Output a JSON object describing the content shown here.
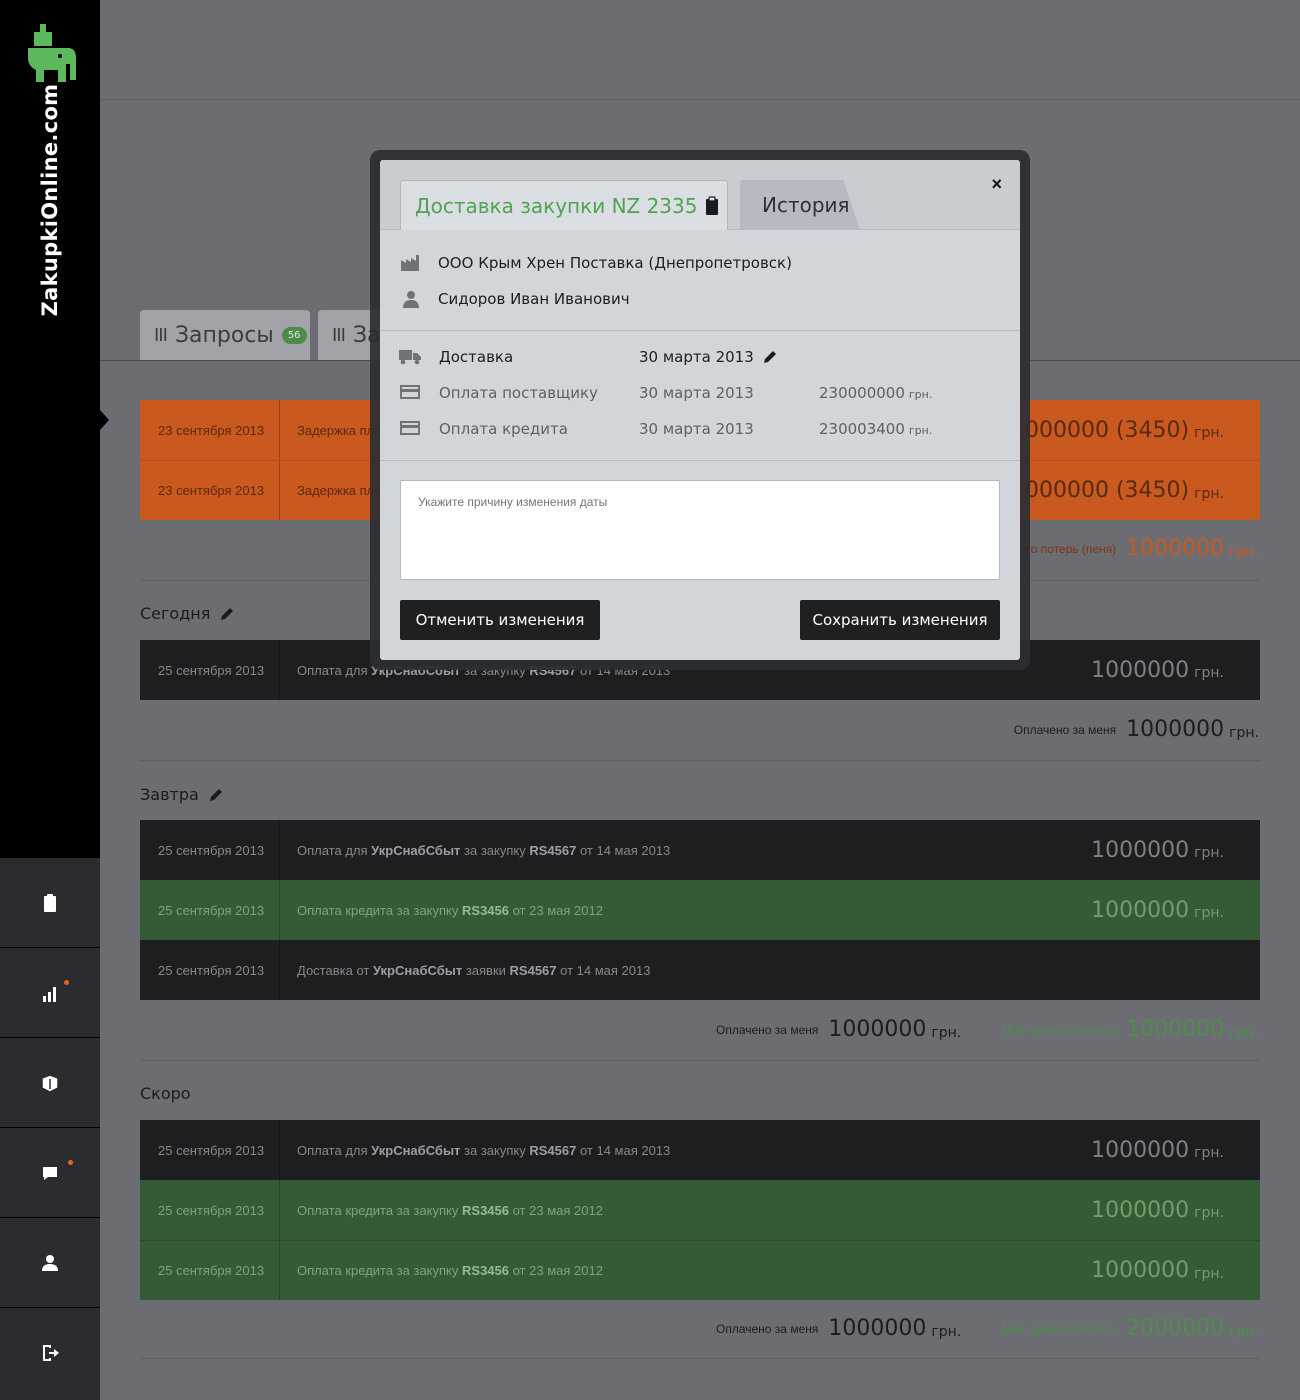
{
  "sidebar": {
    "logo_text": "ZakupkiOnline.com",
    "nav": [
      {
        "icon": "clipboard-icon"
      },
      {
        "icon": "bar-chart-icon",
        "has_notification": true
      },
      {
        "icon": "catalog-icon"
      },
      {
        "icon": "chat-icon",
        "has_notification": true
      },
      {
        "icon": "user-icon"
      },
      {
        "icon": "logout-icon"
      }
    ]
  },
  "tabs": [
    {
      "label": "Запросы",
      "badge": "56"
    },
    {
      "label": "За"
    }
  ],
  "overdue": {
    "rows": [
      {
        "date": "23 сентября 2013",
        "desc": "Задержка пла",
        "amount": "1000000 (3450)",
        "currency": "грн."
      },
      {
        "date": "23 сентября 2013",
        "desc": "Задержка пла",
        "amount": "1000000 (3450)",
        "currency": "грн."
      }
    ],
    "summary": {
      "label": "его потерь (пеня)",
      "value": "1000000",
      "currency": "грн."
    }
  },
  "today": {
    "title": "Сегодня",
    "rows": [
      {
        "date": "25 сентября 2013",
        "p1": "Оплата для ",
        "b1": "УкрСнабСбыт",
        "p2": " за закупку ",
        "b2": "RS4567",
        "p3": " от 14 мая 2013",
        "amount": "1000000",
        "currency": "грн."
      }
    ],
    "summary_paid": {
      "label": "Оплачено за меня",
      "value": "1000000",
      "currency": "грн."
    }
  },
  "tomorrow": {
    "title": "Завтра",
    "rows": [
      {
        "date": "25 сентября 2013",
        "p1": "Оплата для ",
        "b1": "УкрСнабСбыт",
        "p2": " за закупку ",
        "b2": "RS4567",
        "p3": " от 14 мая 2013",
        "amount": "1000000",
        "currency": "грн."
      },
      {
        "date": "25 сентября 2013",
        "p1": "Оплата кредита за закупку ",
        "b1": "RS3456",
        "p2": " от 23 мая 2012",
        "amount": "1000000",
        "currency": "грн."
      },
      {
        "date": "25 сентября 2013",
        "p1": "Доставка от ",
        "b1": "УкрСнабСбыт",
        "p2": " заявки ",
        "b2": "RS4567",
        "p3": " от 14 мая 2013"
      }
    ],
    "summary_paid": {
      "label": "Оплачено за меня",
      "value": "1000000",
      "currency": "грн."
    },
    "summary_due": {
      "label": "Мне нужно оплатить",
      "value": "1000000",
      "currency": "грн."
    }
  },
  "soon": {
    "title": "Скоро",
    "rows": [
      {
        "date": "25 сентября 2013",
        "p1": "Оплата для ",
        "b1": "УкрСнабСбыт",
        "p2": " за закупку ",
        "b2": "RS4567",
        "p3": " от 14 мая 2013",
        "amount": "1000000",
        "currency": "грн."
      },
      {
        "date": "25 сентября 2013",
        "p1": "Оплата кредита за закупку ",
        "b1": "RS3456",
        "p2": " от 23 мая 2012",
        "amount": "1000000",
        "currency": "грн."
      },
      {
        "date": "25 сентября 2013",
        "p1": "Оплата кредита за закупку ",
        "b1": "RS3456",
        "p2": " от 23 мая 2012",
        "amount": "1000000",
        "currency": "грн."
      }
    ],
    "summary_paid": {
      "label": "Оплачено за меня",
      "value": "1000000",
      "currency": "грн."
    },
    "summary_due": {
      "label": "Мне нужно оплатить",
      "value": "2000000",
      "currency": "грн."
    }
  },
  "modal": {
    "tab_active": "Доставка закупки NZ 2335",
    "tab_history": "История",
    "close": "×",
    "company": "ООО Крым Хрен Поставка (Днепропетровск)",
    "person": "Сидоров Иван Иванович",
    "schedule": [
      {
        "label": "Доставка",
        "date": "30 марта 2013"
      },
      {
        "label": "Оплата поставщику",
        "date": "30 марта 2013",
        "amount": "230000000",
        "currency": "грн."
      },
      {
        "label": "Оплата кредита",
        "date": "30 марта 2013",
        "amount": "230003400",
        "currency": "грн."
      }
    ],
    "reason_placeholder": "Укажите причину изменения даты",
    "cancel_label": "Отменить изменения",
    "save_label": "Сохранить изменения"
  },
  "colors": {
    "overdue": "#c9591e",
    "dark_row": "#1d1e20",
    "green_row": "#345a36",
    "accent_green": "#51a351",
    "notification": "#e8661f"
  }
}
